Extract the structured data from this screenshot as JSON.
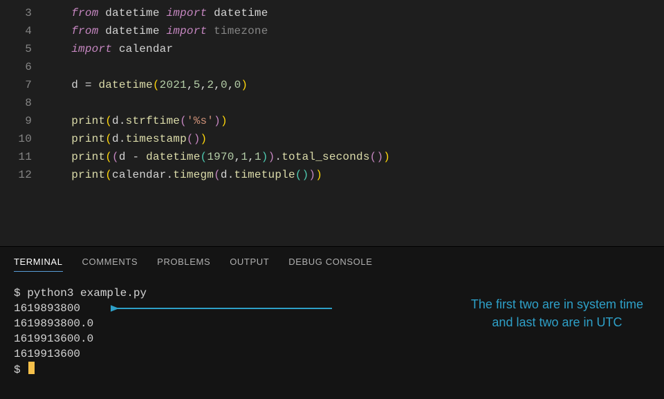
{
  "editor": {
    "lines": [
      {
        "num": "3",
        "prefix": "    "
      },
      {
        "num": "4",
        "prefix": "    "
      },
      {
        "num": "5",
        "prefix": "    "
      },
      {
        "num": "6",
        "prefix": ""
      },
      {
        "num": "7",
        "prefix": "    "
      },
      {
        "num": "8",
        "prefix": ""
      },
      {
        "num": "9",
        "prefix": "    "
      },
      {
        "num": "10",
        "prefix": "    "
      },
      {
        "num": "11",
        "prefix": "    "
      },
      {
        "num": "12",
        "prefix": "    "
      }
    ],
    "tok": {
      "from": "from",
      "import": "import",
      "datetime_mod": "datetime",
      "datetime_cls": "datetime",
      "timezone": "timezone",
      "calendar": "calendar",
      "d": "d",
      "eq": " = ",
      "args_dt2021": "2021",
      "c": ",",
      "n5": "5",
      "n2": "2",
      "n0": "0",
      "print": "print",
      "strftime": "strftime",
      "pct_s": "'%s'",
      "timestamp": "timestamp",
      "minus": " - ",
      "n1970": "1970",
      "n1": "1",
      "dot": ".",
      "total_seconds": "total_seconds",
      "timegm": "timegm",
      "timetuple": "timetuple",
      "sp": " ",
      "lp": "(",
      "rp": ")"
    }
  },
  "panel": {
    "tabs": {
      "terminal": "TERMINAL",
      "comments": "COMMENTS",
      "problems": "PROBLEMS",
      "output": "OUTPUT",
      "debug": "DEBUG CONSOLE"
    },
    "terminal": {
      "prompt": "$ ",
      "cmd": "python3 example.py",
      "out1": "1619893800",
      "out2": "1619893800.0",
      "out3": "1619913600.0",
      "out4": "1619913600"
    },
    "annotation": {
      "line1": "The first two are in system time",
      "line2": "and last two are in UTC"
    }
  }
}
